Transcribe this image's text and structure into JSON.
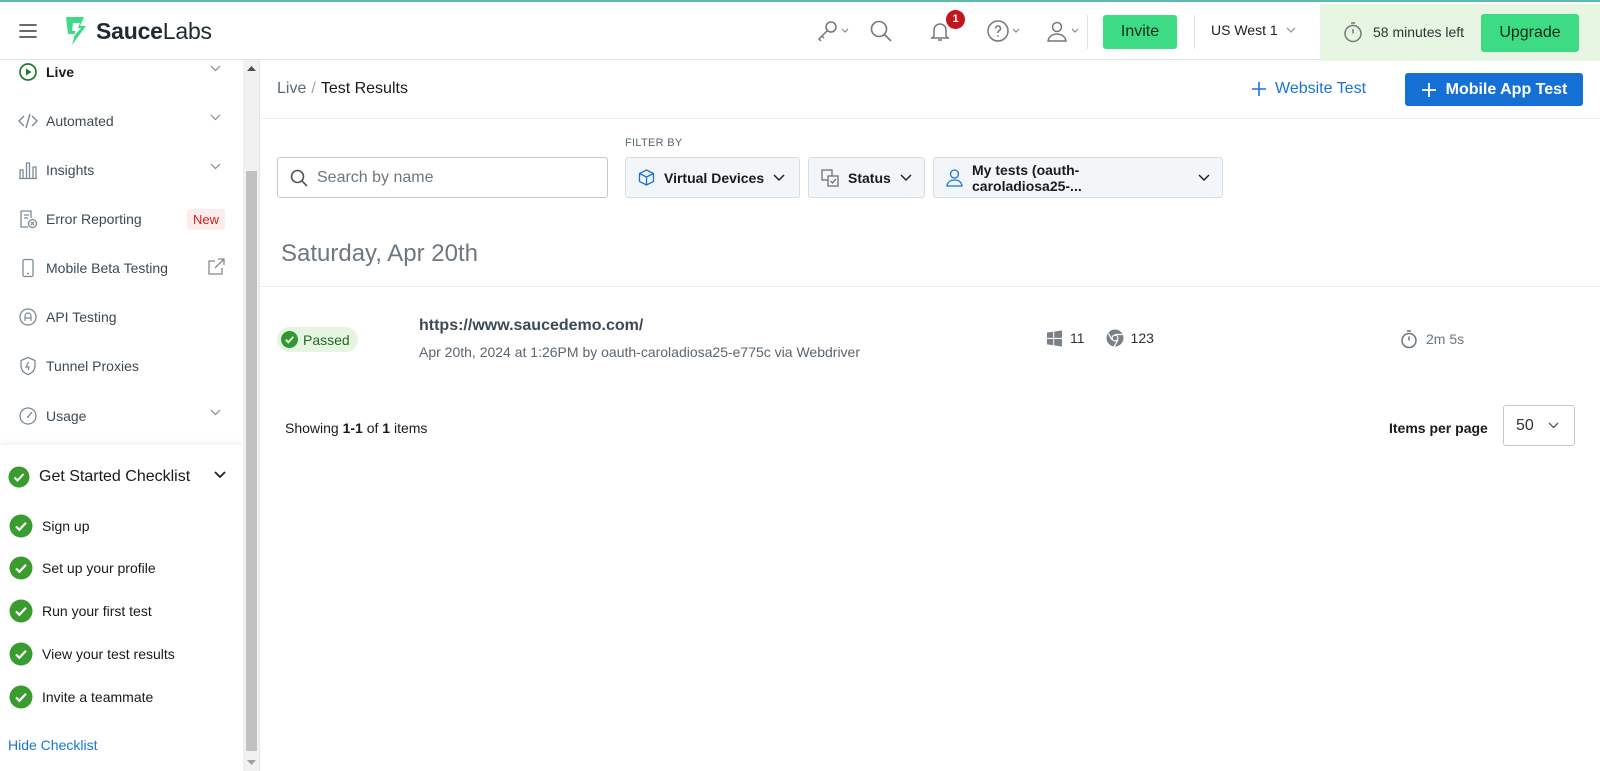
{
  "app": {
    "logo_word_bold": "Sauce",
    "logo_word_light": "Labs",
    "accent_green": "#3ddc84",
    "accent_blue": "#1570d6"
  },
  "topbar": {
    "notifications_count": "1",
    "invite_label": "Invite",
    "region_label": "US West 1",
    "trial_text": "58 minutes left",
    "upgrade_label": "Upgrade"
  },
  "sidebar": {
    "items": [
      {
        "label": "Live",
        "icon": "play-circle-icon"
      },
      {
        "label": "Automated",
        "icon": "code-icon"
      },
      {
        "label": "Insights",
        "icon": "bar-chart-icon"
      },
      {
        "label": "Error Reporting",
        "icon": "error-report-icon",
        "tag": "New"
      },
      {
        "label": "Mobile Beta Testing",
        "icon": "mobile-icon"
      },
      {
        "label": "API Testing",
        "icon": "api-icon"
      },
      {
        "label": "Tunnel Proxies",
        "icon": "shield-icon"
      },
      {
        "label": "Usage",
        "icon": "gauge-icon"
      }
    ],
    "checklist": {
      "title": "Get Started Checklist",
      "items": [
        "Sign up",
        "Set up your profile",
        "Run your first test",
        "View your test results",
        "Invite a teammate"
      ],
      "hide_label": "Hide Checklist"
    }
  },
  "main": {
    "breadcrumb": {
      "parent": "Live",
      "separator": "/",
      "current": "Test Results"
    },
    "website_test_label": "Website Test",
    "mobile_app_test_label": "Mobile App Test",
    "search_placeholder": "Search by name",
    "filter_by_label": "FILTER BY",
    "filters": {
      "devices": "Virtual Devices",
      "status": "Status",
      "owner": "My tests (oauth-caroladiosa25-..."
    },
    "date_heading": "Saturday, Apr 20th",
    "tests": [
      {
        "status": "Passed",
        "url": "https://www.saucedemo.com/",
        "meta": "Apr 20th, 2024 at 1:26PM by oauth-caroladiosa25-e775c via Webdriver",
        "os_version": "11",
        "browser_version": "123",
        "duration": "2m 5s"
      }
    ],
    "pagination": {
      "showing_prefix": "Showing",
      "range": "1-1",
      "of_word": "of",
      "total": "1",
      "items_word": "items",
      "items_per_page_label": "Items per page",
      "items_per_page_value": "50"
    }
  }
}
